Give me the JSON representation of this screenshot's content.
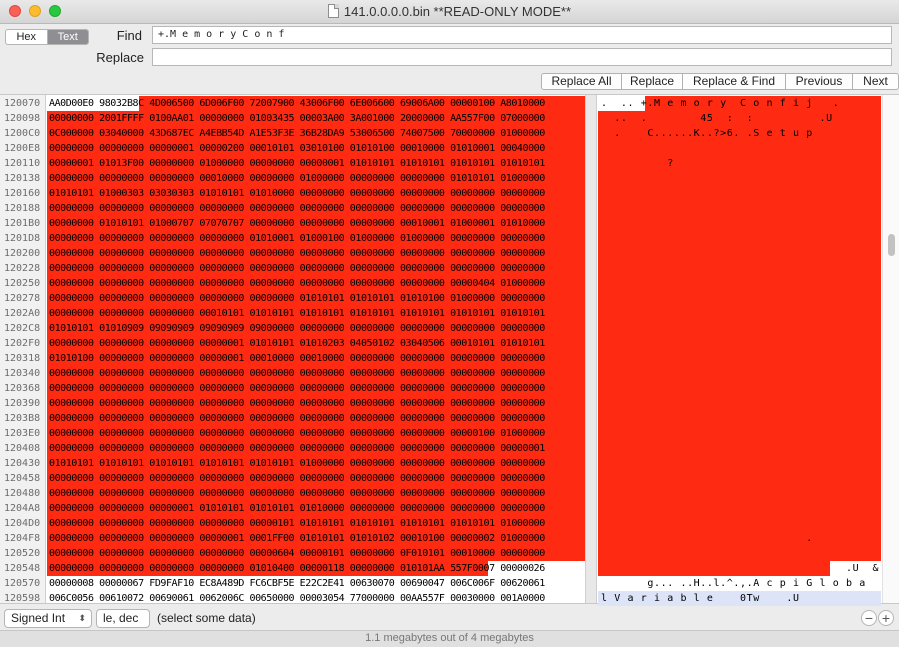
{
  "window": {
    "title": "141.0.0.0.0.bin **READ-ONLY MODE**"
  },
  "modes": {
    "hex": "Hex",
    "text": "Text",
    "selected": "Text"
  },
  "find": {
    "label": "Find",
    "value": "+.M e m o r y C o n f"
  },
  "replace": {
    "label": "Replace",
    "value": ""
  },
  "buttons": {
    "replace_all": "Replace All",
    "replace": "Replace",
    "replace_find": "Replace & Find",
    "previous": "Previous",
    "next": "Next"
  },
  "hex": {
    "highlight_color": "#ff2a12",
    "rows": [
      {
        "addr": "120070",
        "hex": "AA0D00E0 98032B8C 4D006500 6D006F00 72007900 43006F00 6E006600 69006A00 00000100 A8010000",
        "text": ".  .. +.M e m o r y  C o n f i j   ."
      },
      {
        "addr": "120098",
        "hex": "00000000 2001FFFF 0100AA01 00000000 01003435 00003A00 3A001000 20000000 AA557F00 07000000",
        "text": "  ..  .        45  :  :          .U"
      },
      {
        "addr": "1200C0",
        "hex": "0C000000 03040000 43D687EC A4EBB54D A1E53F3E 36B28DA9 53006500 74007500 70000000 01000000",
        "text": "  .    C......K..?>6. .S e t u p"
      },
      {
        "addr": "1200E8",
        "hex": "00000000 00000000 00000001 00000200 00010101 03010100 01010100 00010000 01010001 00040000",
        "text": ""
      },
      {
        "addr": "120110",
        "hex": "00000001 01013F00 00000000 01000000 00000000 00000001 01010101 01010101 01010101 01010101",
        "text": "          ?"
      },
      {
        "addr": "120138",
        "hex": "00000000 00000000 00000000 00010000 00000000 01000000 00000000 00000000 01010101 01000000",
        "text": ""
      },
      {
        "addr": "120160",
        "hex": "01010101 01000303 03030303 01010101 01010000 00000000 00000000 00000000 00000000 00000000",
        "text": ""
      },
      {
        "addr": "120188",
        "hex": "00000000 00000000 00000000 00000000 00000000 00000000 00000000 00000000 00000000 00000000",
        "text": ""
      },
      {
        "addr": "1201B0",
        "hex": "00000000 01010101 01000707 07070707 00000000 00000000 00000000 00010001 01000001 01010000",
        "text": ""
      },
      {
        "addr": "1201D8",
        "hex": "00000000 00000000 00000000 00000000 01010001 01000100 01000000 01000000 00000000 00000000",
        "text": ""
      },
      {
        "addr": "120200",
        "hex": "00000000 00000000 00000000 00000000 00000000 00000000 00000000 00000000 00000000 00000000",
        "text": ""
      },
      {
        "addr": "120228",
        "hex": "00000000 00000000 00000000 00000000 00000000 00000000 00000000 00000000 00000000 00000000",
        "text": ""
      },
      {
        "addr": "120250",
        "hex": "00000000 00000000 00000000 00000000 00000000 00000000 00000000 00000000 00000404 01000000",
        "text": ""
      },
      {
        "addr": "120278",
        "hex": "00000000 00000000 00000000 00000000 00000000 01010101 01010101 01010100 01000000 00000000",
        "text": ""
      },
      {
        "addr": "1202A0",
        "hex": "00000000 00000000 00000000 00010101 01010101 01010101 01010101 01010101 01010101 01010101",
        "text": ""
      },
      {
        "addr": "1202C8",
        "hex": "01010101 01010909 09090909 09090909 09000000 00000000 00000000 00000000 00000000 00000000",
        "text": ""
      },
      {
        "addr": "1202F0",
        "hex": "00000000 00000000 00000000 00000001 01010101 01010203 04050102 03040506 00010101 01010101",
        "text": ""
      },
      {
        "addr": "120318",
        "hex": "01010100 00000000 00000000 00000001 00010000 00010000 00000000 00000000 00000000 00000000",
        "text": ""
      },
      {
        "addr": "120340",
        "hex": "00000000 00000000 00000000 00000000 00000000 00000000 00000000 00000000 00000000 00000000",
        "text": ""
      },
      {
        "addr": "120368",
        "hex": "00000000 00000000 00000000 00000000 00000000 00000000 00000000 00000000 00000000 00000000",
        "text": ""
      },
      {
        "addr": "120390",
        "hex": "00000000 00000000 00000000 00000000 00000000 00000000 00000000 00000000 00000000 00000000",
        "text": ""
      },
      {
        "addr": "1203B8",
        "hex": "00000000 00000000 00000000 00000000 00000000 00000000 00000000 00000000 00000000 00000000",
        "text": ""
      },
      {
        "addr": "1203E0",
        "hex": "00000000 00000000 00000000 00000000 00000000 00000000 00000000 00000000 00000100 01000000",
        "text": ""
      },
      {
        "addr": "120408",
        "hex": "00000000 00000000 00000000 00000000 00000000 00000000 00000000 00000000 00000000 00000001",
        "text": ""
      },
      {
        "addr": "120430",
        "hex": "01010101 01010101 01010101 01010101 01010101 01000000 00000000 00000000 00000000 00000000",
        "text": ""
      },
      {
        "addr": "120458",
        "hex": "00000000 00000000 00000000 00000000 00000000 00000000 00000000 00000000 00000000 00000000",
        "text": ""
      },
      {
        "addr": "120480",
        "hex": "00000000 00000000 00000000 00000000 00000000 00000000 00000000 00000000 00000000 00000000",
        "text": ""
      },
      {
        "addr": "1204A8",
        "hex": "00000000 00000000 00000001 01010101 01010101 01010000 00000000 00000000 00000000 00000000",
        "text": ""
      },
      {
        "addr": "1204D0",
        "hex": "00000000 00000000 00000000 00000000 00000101 01010101 01010101 01010101 01010101 01000000",
        "text": ""
      },
      {
        "addr": "1204F8",
        "hex": "00000000 00000000 00000000 00000001 0001FF00 01010101 01010102 00010100 00000002 01000000",
        "text": "                               ."
      },
      {
        "addr": "120520",
        "hex": "00000000 00000000 00000000 00000000 00000604 00000101 00000000 0F010101 00010000 00000000",
        "text": ""
      },
      {
        "addr": "120548",
        "hex": "00000000 00000000 00000000 00000000 01010400 00000118 00000000 010101AA 557F0007 00000026",
        "text": "                                     .U  &"
      },
      {
        "addr": "120570",
        "hex": "00000008 00000067 FD9FAF10 EC8A489D FC6CBF5E E22C2E41 00630070 00690047 006C006F 00620061",
        "text": "       g... ..H..l.^.,.A c p i G l o b a"
      },
      {
        "addr": "120598",
        "hex": "006C0056 00610072 00690061 0062006C 00650000 00003054 77000000 00AA557F 00030000 001A0000",
        "text": "l V a r i a b l e    0Tw    .U"
      }
    ]
  },
  "status": {
    "type": "Signed Int",
    "endian": "le, dec",
    "message": "(select some data)",
    "minus": "−",
    "plus": "+"
  },
  "footer": {
    "text": "1.1 megabytes out of 4 megabytes"
  }
}
